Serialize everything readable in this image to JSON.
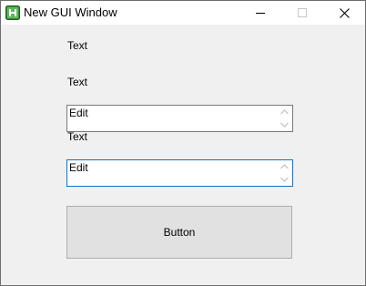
{
  "window": {
    "title": "New GUI Window"
  },
  "labels": [
    "Text",
    "Text",
    "Text"
  ],
  "edits": [
    {
      "value": "Edit"
    },
    {
      "value": "Edit"
    }
  ],
  "button": {
    "label": "Button"
  },
  "colors": {
    "client_background": "#f0f0f0",
    "focus_border": "#0078d7",
    "button_face": "#e1e1e1",
    "app_icon_green": "#3a8a3a"
  }
}
